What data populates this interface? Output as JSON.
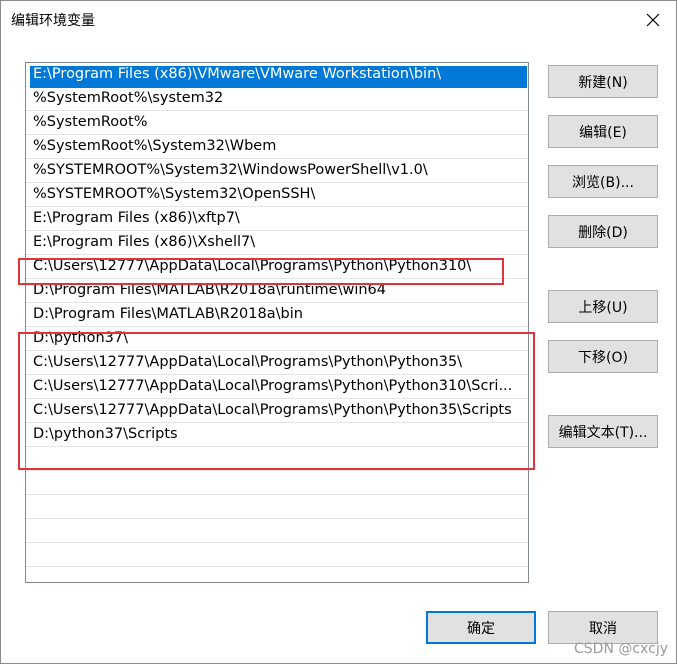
{
  "window": {
    "title": "编辑环境变量",
    "close_icon": "close-icon"
  },
  "paths": [
    "E:\\Program Files (x86)\\VMware\\VMware Workstation\\bin\\",
    "%SystemRoot%\\system32",
    "%SystemRoot%",
    "%SystemRoot%\\System32\\Wbem",
    "%SYSTEMROOT%\\System32\\WindowsPowerShell\\v1.0\\",
    "%SYSTEMROOT%\\System32\\OpenSSH\\",
    "E:\\Program Files (x86)\\xftp7\\",
    "E:\\Program Files (x86)\\Xshell7\\",
    "C:\\Users\\12777\\AppData\\Local\\Programs\\Python\\Python310\\",
    "D:\\Program Files\\MATLAB\\R2018a\\runtime\\win64",
    "D:\\Program Files\\MATLAB\\R2018a\\bin",
    "D:\\python37\\",
    "C:\\Users\\12777\\AppData\\Local\\Programs\\Python\\Python35\\",
    "C:\\Users\\12777\\AppData\\Local\\Programs\\Python\\Python310\\Scri...",
    "C:\\Users\\12777\\AppData\\Local\\Programs\\Python\\Python35\\Scripts",
    "D:\\python37\\Scripts"
  ],
  "selected_index": 0,
  "buttons": {
    "new": "新建(N)",
    "edit": "编辑(E)",
    "browse": "浏览(B)...",
    "delete": "删除(D)",
    "move_up": "上移(U)",
    "move_down": "下移(O)",
    "edit_text": "编辑文本(T)...",
    "ok": "确定",
    "cancel": "取消"
  },
  "watermark": "CSDN @cxcjy",
  "colors": {
    "selection": "#0078d7",
    "annotation": "#e0333c"
  }
}
